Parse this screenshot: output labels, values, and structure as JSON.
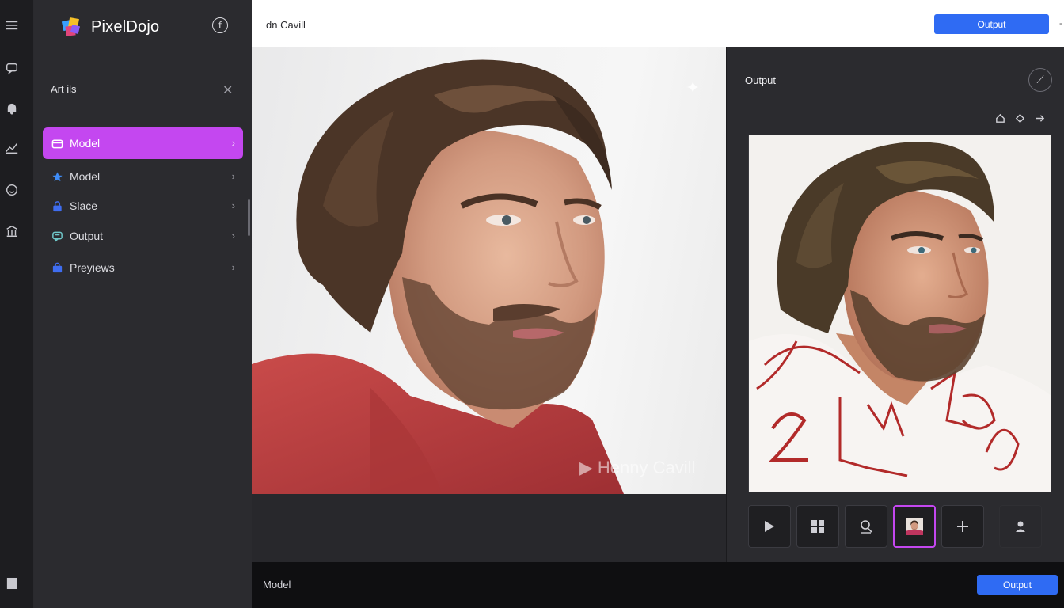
{
  "app": {
    "brand": "PixelDojo",
    "info_glyph": "f"
  },
  "rail": {
    "icons": [
      "menu-icon",
      "chat-icon",
      "bell-icon",
      "chart-icon",
      "smile-icon",
      "library-icon",
      "bookmark-icon"
    ]
  },
  "panel": {
    "title": "Art ils",
    "close_glyph": "✕",
    "items": [
      {
        "label": "Model",
        "icon": "folder-icon",
        "active": true
      },
      {
        "label": "Model",
        "icon": "star-icon",
        "active": false
      },
      {
        "label": "Slace",
        "icon": "lock-icon",
        "active": false
      },
      {
        "label": "Output",
        "icon": "chat-bubble-icon",
        "active": false
      },
      {
        "label": "Preyiews",
        "icon": "bag-icon",
        "active": false
      }
    ],
    "chevron": "›"
  },
  "topbar": {
    "title": "dn Cavill",
    "output_label": "Output",
    "caret": "-"
  },
  "canvas": {
    "watermark": "Henny Cavill"
  },
  "output_panel": {
    "title": "Output",
    "action_glyph": "⟋"
  },
  "bottombar": {
    "label": "Model",
    "output_label": "Output"
  },
  "colors": {
    "accent": "#c447f0",
    "primary": "#2f6bf3",
    "sidebar": "#2b2b2f"
  }
}
